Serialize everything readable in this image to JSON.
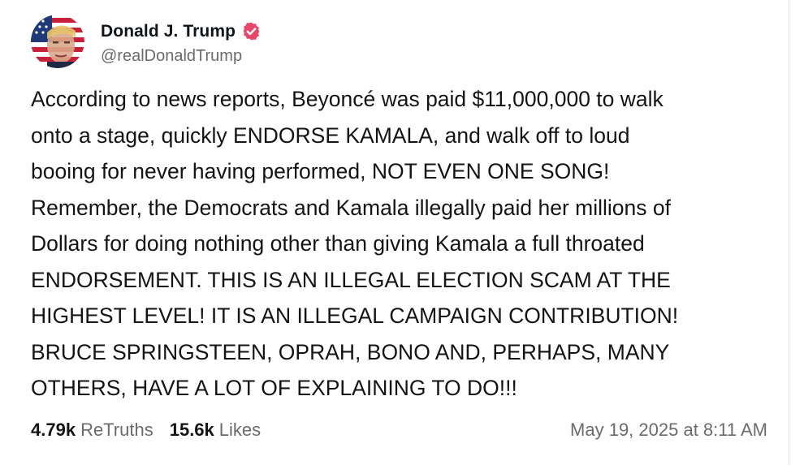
{
  "post": {
    "author": {
      "display_name": "Donald J. Trump",
      "handle": "@realDonaldTrump",
      "verified_badge_color": "#e8456b",
      "avatar_icon": "avatar-image"
    },
    "text": "According to news reports, Beyoncé was paid $11,000,000 to walk\nonto a stage, quickly ENDORSE KAMALA, and walk off to loud\nbooing for never having performed, NOT EVEN ONE SONG!\nRemember, the Democrats and Kamala illegally paid her millions of\nDollars for doing nothing other than giving Kamala a full throated\nENDORSEMENT. THIS IS AN ILLEGAL ELECTION SCAM AT THE\nHIGHEST LEVEL! IT IS AN ILLEGAL CAMPAIGN CONTRIBUTION!\nBRUCE SPRINGSTEEN, OPRAH, BONO AND,  PERHAPS, MANY\nOTHERS, HAVE A LOT OF EXPLAINING TO DO!!!",
    "stats": {
      "retruths_count": "4.79k",
      "retruths_label": "ReTruths",
      "likes_count": "15.6k",
      "likes_label": "Likes"
    },
    "timestamp": "May 19, 2025 at 8:11 AM"
  }
}
